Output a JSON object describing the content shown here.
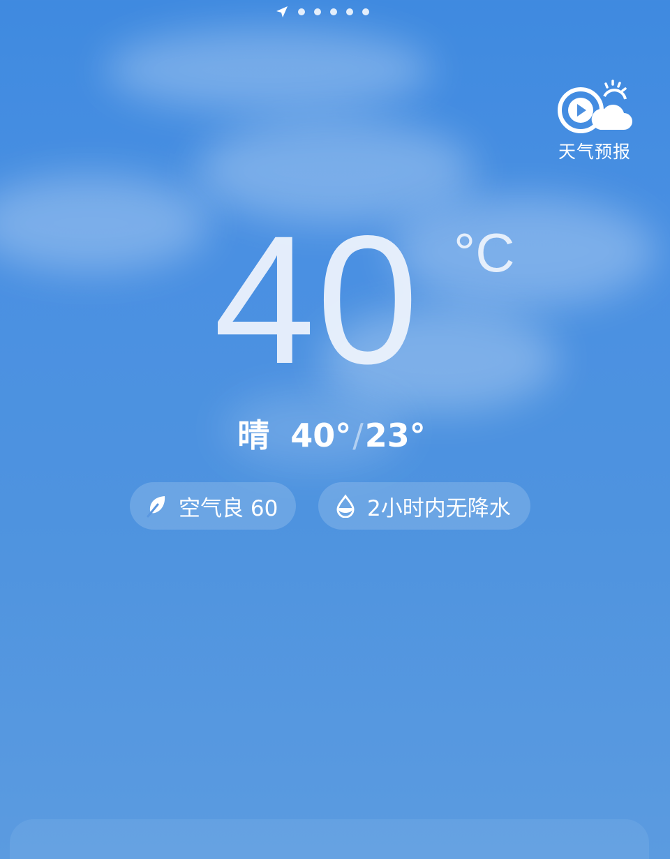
{
  "pager": {
    "location_icon": "location-arrow-icon",
    "dot_count_label": "5"
  },
  "forecast_entry": {
    "icon": "weather-video-icon",
    "label": "天气预报"
  },
  "current": {
    "temperature": "40",
    "unit": "°C",
    "condition": "晴",
    "high": "40°",
    "separator": "/",
    "low": "23°"
  },
  "chips": {
    "aqi": {
      "icon": "leaf-icon",
      "label": "空气良 60"
    },
    "rain": {
      "icon": "water-drop-icon",
      "label": "2小时内无降水"
    }
  },
  "colors": {
    "sky_top": "#3f8ae0",
    "sky_bottom": "#5b9be0",
    "text": "#ffffff"
  }
}
